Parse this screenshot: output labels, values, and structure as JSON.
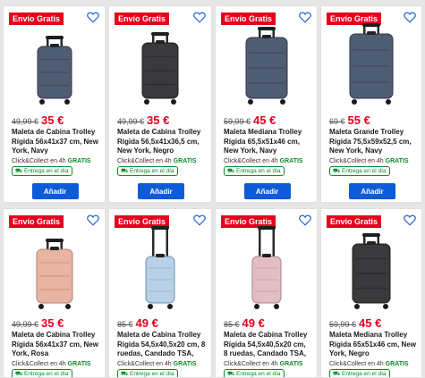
{
  "labels": {
    "badge": "Envío Gratis",
    "clickcollect": "Click&Collect en 4h",
    "free": "GRATIS",
    "delivery": "Entrega en el día",
    "add": "Añadir"
  },
  "colors": {
    "accent": "#e5001c",
    "button": "#0d5bd7",
    "free": "#0b8a25"
  },
  "products": [
    {
      "old_price": "49,99 €",
      "price": "35 €",
      "title": "Maleta de Cabina Trolley Rígida 56x41x37 cm, New York, Navy",
      "color": "navy"
    },
    {
      "old_price": "49,99 €",
      "price": "35 €",
      "title": "Maleta de Cabina Trolley Rígida 56,5x41x36,5 cm, New York, Negro",
      "color": "black"
    },
    {
      "old_price": "59,99 €",
      "price": "45 €",
      "title": "Maleta Mediana Trolley Rígida 65,5x51x46 cm, New York, Navy",
      "color": "navy"
    },
    {
      "old_price": "69 €",
      "price": "55 €",
      "title": "Maleta Grande Trolley Rígida 75,5x59x52,5 cm, New York, Navy",
      "color": "navy"
    },
    {
      "old_price": "49,99 €",
      "price": "35 €",
      "title": "Maleta de Cabina Trolley Rígida 56x41x37 cm, New York, Rosa",
      "color": "rose"
    },
    {
      "old_price": "85 €",
      "price": "49 €",
      "title": "Maleta de Cabina Trolley Rígida 54,5x40,5x20 cm, 8 ruedas, Candado TSA,",
      "color": "lightblue"
    },
    {
      "old_price": "85 €",
      "price": "49 €",
      "title": "Maleta de Cabina Trolley Rígida 54,5x40,5x20 cm, 8 ruedas, Candado TSA,",
      "color": "pink"
    },
    {
      "old_price": "59,99 €",
      "price": "45 €",
      "title": "Maleta Mediana Trolley Rígida 65x51x46 cm, New York, Negro",
      "color": "black"
    }
  ]
}
